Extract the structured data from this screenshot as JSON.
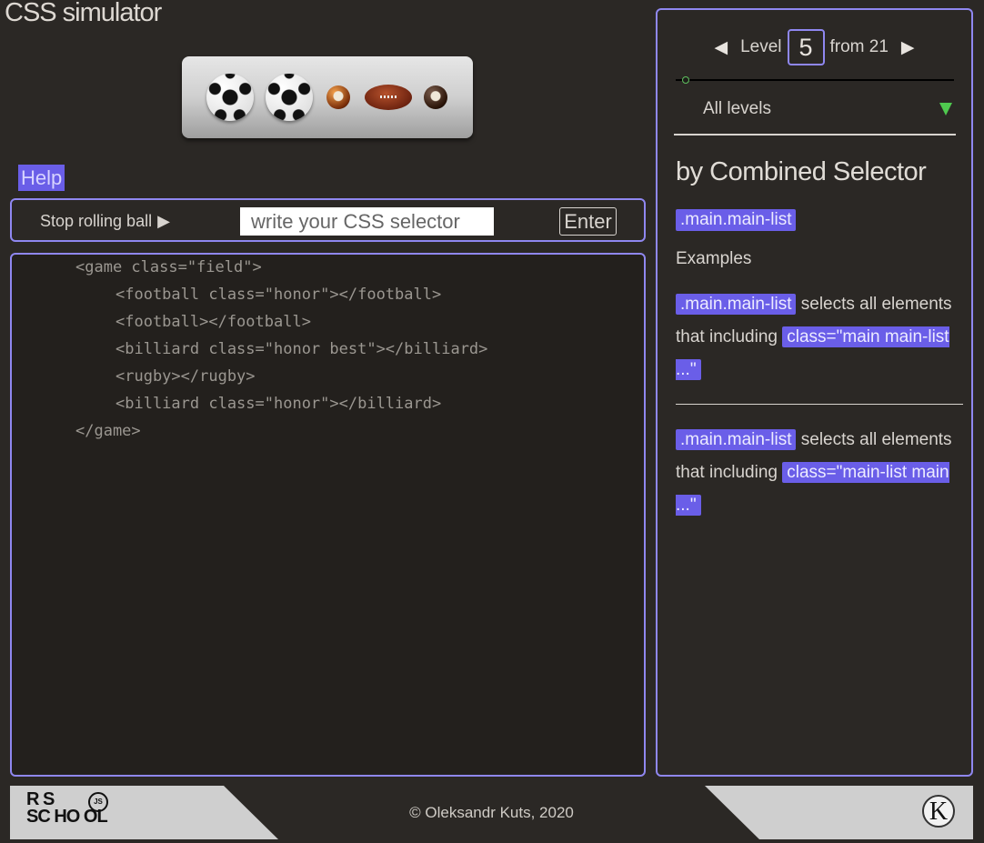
{
  "app": {
    "title": "CSS simulator"
  },
  "table": {
    "items": [
      {
        "type": "football",
        "icon": "soccer-ball-icon"
      },
      {
        "type": "football",
        "icon": "soccer-ball-icon"
      },
      {
        "type": "billiard",
        "icon": "billiard-ball-icon"
      },
      {
        "type": "rugby",
        "icon": "rugby-ball-icon"
      },
      {
        "type": "billiard",
        "icon": "billiard-ball-icon"
      }
    ]
  },
  "help": {
    "label": "Help"
  },
  "controls": {
    "stop_label": "Stop rolling ball",
    "stop_icon": "▶",
    "input_placeholder": "write your CSS selector",
    "input_value": "",
    "enter_label": "Enter"
  },
  "code": {
    "lines": [
      "<game class=\"field\">",
      "<football class=\"honor\"></football>",
      "<football></football>",
      "<billiard class=\"honor best\"></billiard>",
      "<rugby></rugby>",
      "<billiard class=\"honor\"></billiard>",
      "</game>"
    ]
  },
  "level": {
    "prev_icon": "◀",
    "next_icon": "▶",
    "label": "Level",
    "current": "5",
    "from_label": "from 21",
    "progress_fraction": 0.05,
    "all_levels_label": "All levels"
  },
  "lesson": {
    "topic": "by Combined Selector",
    "selector": ".main.main-list",
    "examples_title": "Examples",
    "examples": [
      {
        "selector": ".main.main-list",
        "text": "selects all elements that including",
        "match": "class=\"main main-list ...\""
      },
      {
        "selector": ".main.main-list",
        "text": "selects all elements that including",
        "match": "class=\"main-list main ...\""
      }
    ]
  },
  "footer": {
    "logo_line1": "R  S",
    "logo_line2": "SC HO OL",
    "logo_badge": "JS",
    "copyright": "© Oleksandr Kuts, 2020",
    "author_logo": "K"
  },
  "colors": {
    "background": "#2b2825",
    "accent": "#6a5ee8",
    "border": "#8f87f0",
    "progress": "#4fc94f"
  }
}
